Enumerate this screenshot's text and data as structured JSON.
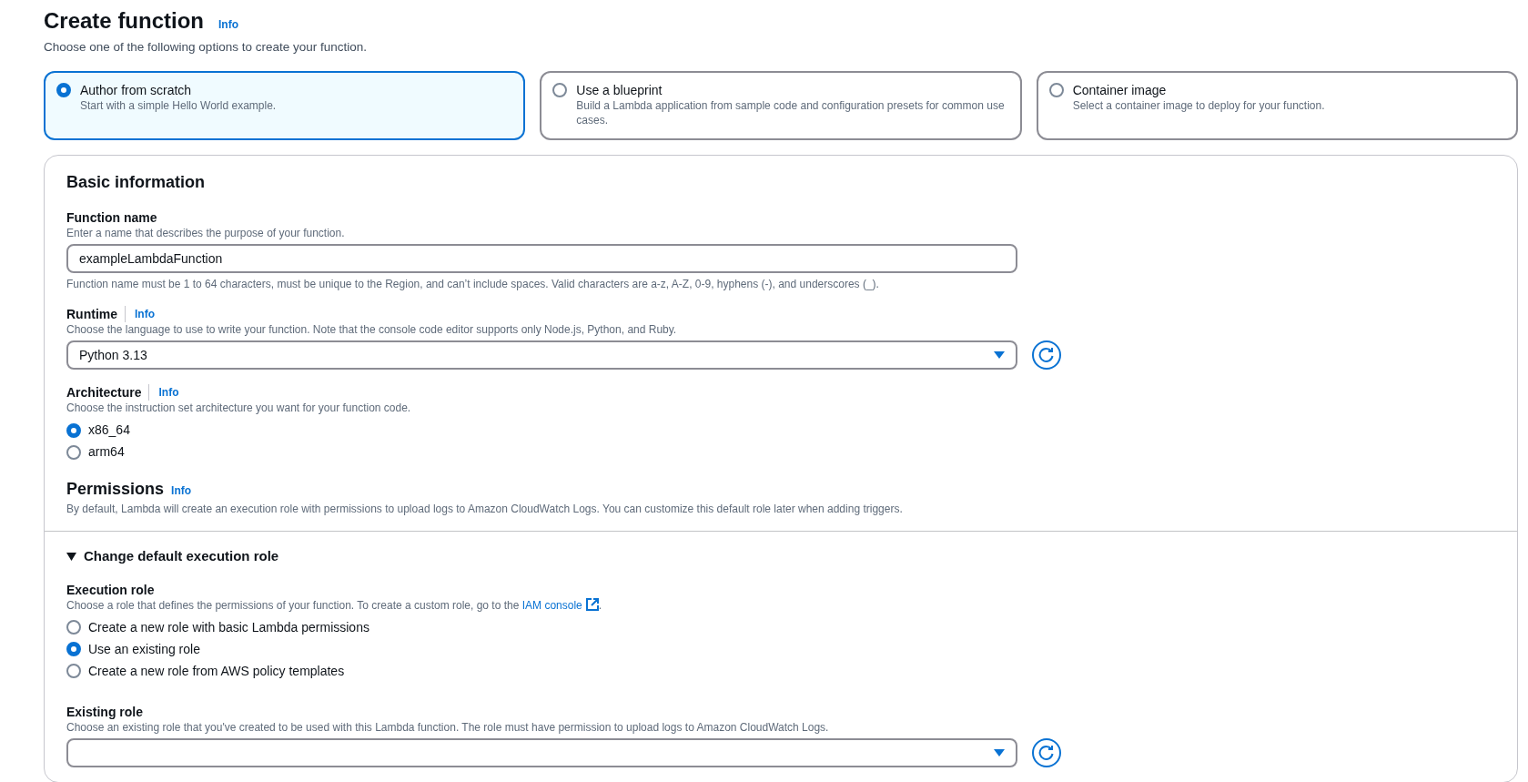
{
  "header": {
    "title": "Create function",
    "info": "Info",
    "description": "Choose one of the following options to create your function."
  },
  "options": [
    {
      "title": "Author from scratch",
      "description": "Start with a simple Hello World example.",
      "selected": true
    },
    {
      "title": "Use a blueprint",
      "description": "Build a Lambda application from sample code and configuration presets for common use cases.",
      "selected": false
    },
    {
      "title": "Container image",
      "description": "Select a container image to deploy for your function.",
      "selected": false
    }
  ],
  "basic_information": {
    "title": "Basic information",
    "function_name": {
      "label": "Function name",
      "description": "Enter a name that describes the purpose of your function.",
      "value": "exampleLambdaFunction",
      "constraint": "Function name must be 1 to 64 characters, must be unique to the Region, and can’t include spaces. Valid characters are a-z, A-Z, 0-9, hyphens (-), and underscores (_)."
    },
    "runtime": {
      "label": "Runtime",
      "info": "Info",
      "description": "Choose the language to use to write your function. Note that the console code editor supports only Node.js, Python, and Ruby.",
      "value": "Python 3.13"
    },
    "architecture": {
      "label": "Architecture",
      "info": "Info",
      "description": "Choose the instruction set architecture you want for your function code.",
      "options": [
        {
          "label": "x86_64",
          "selected": true
        },
        {
          "label": "arm64",
          "selected": false
        }
      ]
    },
    "permissions": {
      "title": "Permissions",
      "info": "Info",
      "description": "By default, Lambda will create an execution role with permissions to upload logs to Amazon CloudWatch Logs. You can customize this default role later when adding triggers."
    }
  },
  "execution_role_section": {
    "title": "Change default execution role",
    "expanded": true,
    "execution_role": {
      "label": "Execution role",
      "description": "Choose a role that defines the permissions of your function. To create a custom role, go to the",
      "link": "IAM console",
      "description_end": ".",
      "options": [
        {
          "label": "Create a new role with basic Lambda permissions",
          "selected": false
        },
        {
          "label": "Use an existing role",
          "selected": true
        },
        {
          "label": "Create a new role from AWS policy templates",
          "selected": false
        }
      ]
    },
    "existing_role": {
      "label": "Existing role",
      "description": "Choose an existing role that you've created to be used with this Lambda function. The role must have permission to upload logs to Amazon CloudWatch Logs."
    }
  }
}
